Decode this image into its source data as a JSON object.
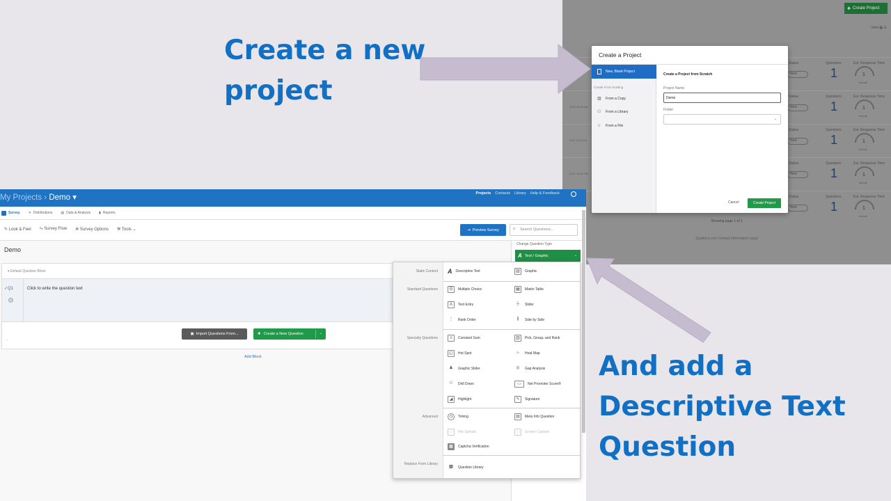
{
  "slide": {
    "heading_top": "Create a new project",
    "heading_bottom": "And add a Descriptive Text Question",
    "arrow_color": "#c6bcd0",
    "heading_color": "#1170c4"
  },
  "projects_page": {
    "create_button": "Create Project",
    "view_label": "View",
    "rows": [
      {
        "status_label": "Status",
        "questions_label": "Questions",
        "response_label": "Est. Response Time",
        "status": "New",
        "questions": "1",
        "time": "1",
        "unit": "minute",
        "date": ""
      },
      {
        "status_label": "Status",
        "questions_label": "Questions",
        "response_label": "Est. Response Time",
        "status": "New",
        "questions": "1",
        "time": "1",
        "unit": "minute",
        "date": "2018 10:05 AM"
      },
      {
        "status_label": "Status",
        "questions_label": "Questions",
        "response_label": "Est. Response Time",
        "status": "New",
        "questions": "1",
        "time": "1",
        "unit": "minute",
        "date": "2017 3:00 PM"
      },
      {
        "status_label": "Status",
        "questions_label": "Questions",
        "response_label": "Est. Response Time",
        "status": "New",
        "questions": "1",
        "time": "1",
        "unit": "minute",
        "date": "2017 10:00 PM"
      },
      {
        "status_label": "Status",
        "questions_label": "Questions",
        "response_label": "Est. Response Time",
        "status": "New",
        "questions": "1",
        "time": "1",
        "unit": "minute",
        "date": ""
      }
    ],
    "showing": "Showing page 1 of 1",
    "footer": "Qualtrics.com   Contact Information   Legal"
  },
  "modal": {
    "title": "Create a Project",
    "side_active": "New, Blank Project",
    "side_heading": "Create From Existing",
    "side_items": [
      "From a Copy",
      "From a Library",
      "From a File"
    ],
    "heading": "Create a Project from Scratch",
    "name_label": "Project Name",
    "name_value": "Demo",
    "folder_label": "Folder",
    "cancel": "Cancel",
    "create": "Create Project"
  },
  "editor": {
    "brand": "My Projects",
    "project_name": "Demo",
    "top_nav": [
      "Projects",
      "Contacts",
      "Library",
      "Help & Feedback"
    ],
    "tabs": [
      "Survey",
      "Distributions",
      "Data & Analysis",
      "Reports"
    ],
    "tools": [
      "Look & Feel",
      "Survey Flow",
      "Survey Options",
      "Tools"
    ],
    "preview": "Preview Survey",
    "search_placeholder": "Search Questions...",
    "survey_title": "Demo",
    "block_name": "Default Question Block",
    "question_id": "Q1",
    "question_text": "Click to write the question text",
    "import_btn": "Import Questions From...",
    "new_question_btn": "Create a New Question",
    "add_block": "Add Block",
    "change_type_label": "Change Question Type",
    "change_type_value": "Text / Graphic"
  },
  "question_menu": {
    "categories": [
      "Static Content",
      "Standard Questions",
      "Specialty Questions",
      "Advanced",
      "Replace From Library"
    ],
    "static": [
      "Descriptive Text",
      "Graphic"
    ],
    "standard": [
      "Multiple Choice",
      "Matrix Table",
      "Text Entry",
      "Slider",
      "Rank Order",
      "Side by Side"
    ],
    "specialty": [
      "Constant Sum",
      "Pick, Group, and Rank",
      "Hot Spot",
      "Heat Map",
      "Graphic Slider",
      "Gap Analysis",
      "Drill Down",
      "Net Promoter Score®",
      "Highlight",
      "Signature"
    ],
    "advanced": [
      "Timing",
      "Meta Info Question",
      "File Upload",
      "Screen Capture",
      "Captcha Verification"
    ],
    "library": [
      "Question Library"
    ]
  }
}
